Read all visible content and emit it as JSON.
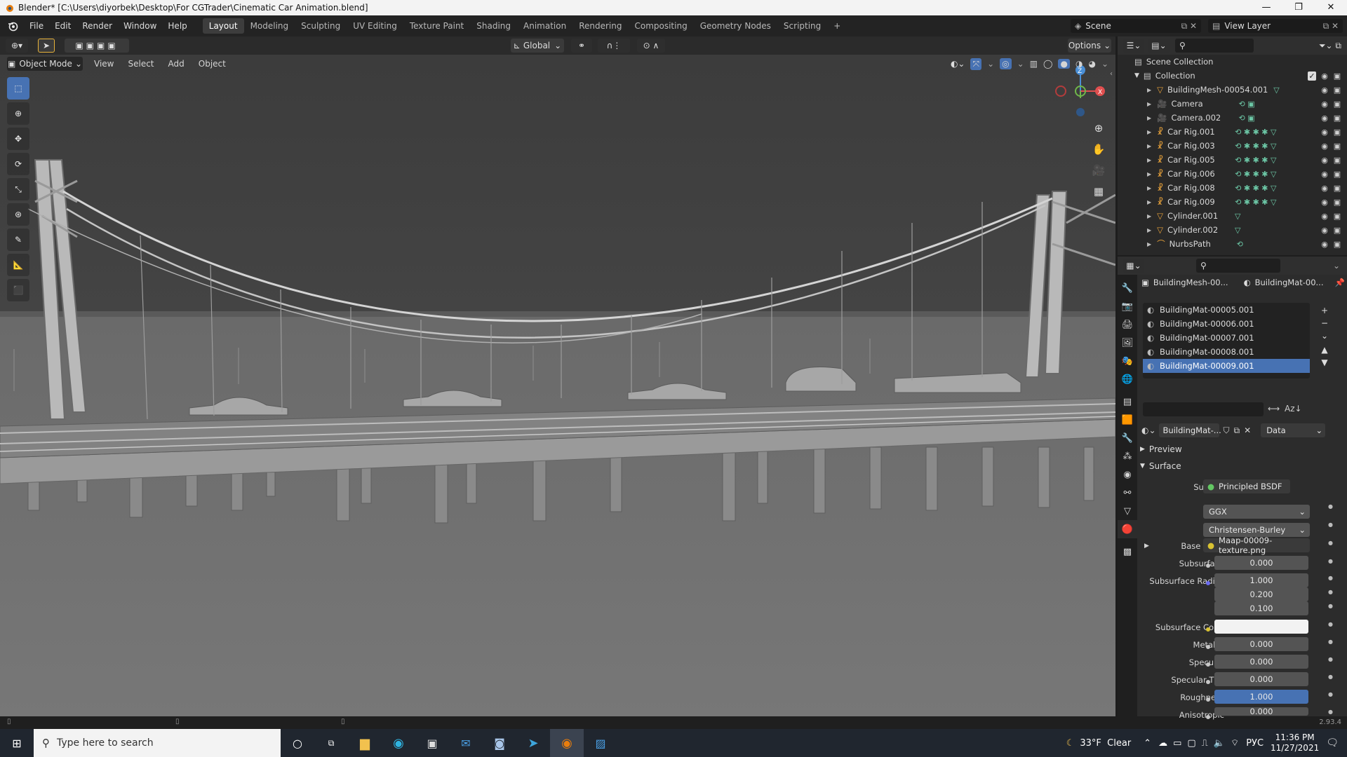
{
  "window": {
    "title": "Blender* [C:\\Users\\diyorbek\\Desktop\\For CGTrader\\Cinematic Car Animation.blend]",
    "controls": [
      "—",
      "❐",
      "✕"
    ]
  },
  "menu": {
    "items": [
      "File",
      "Edit",
      "Render",
      "Window",
      "Help"
    ]
  },
  "workspaces": [
    "Layout",
    "Modeling",
    "Sculpting",
    "UV Editing",
    "Texture Paint",
    "Shading",
    "Animation",
    "Rendering",
    "Compositing",
    "Geometry Nodes",
    "Scripting",
    "+"
  ],
  "active_workspace": "Layout",
  "scene": {
    "name": "Scene",
    "view_layer": "View Layer"
  },
  "viewport_header": {
    "transform_orientation": "Global",
    "options": "Options",
    "mode": "Object Mode",
    "menus": [
      "View",
      "Select",
      "Add",
      "Object"
    ]
  },
  "gizmo": {
    "z": "Z",
    "x": "X",
    "y": "Y"
  },
  "outliner": {
    "scene_collection": "Scene Collection",
    "collection": "Collection",
    "items": [
      {
        "name": "BuildingMesh-00054.001",
        "type": "mesh"
      },
      {
        "name": "Camera",
        "type": "camera"
      },
      {
        "name": "Camera.002",
        "type": "camera"
      },
      {
        "name": "Car Rig.001",
        "type": "armature"
      },
      {
        "name": "Car Rig.003",
        "type": "armature"
      },
      {
        "name": "Car Rig.005",
        "type": "armature"
      },
      {
        "name": "Car Rig.006",
        "type": "armature"
      },
      {
        "name": "Car Rig.008",
        "type": "armature"
      },
      {
        "name": "Car Rig.009",
        "type": "armature"
      },
      {
        "name": "Cylinder.001",
        "type": "mesh"
      },
      {
        "name": "Cylinder.002",
        "type": "mesh"
      },
      {
        "name": "NurbsPath",
        "type": "curve"
      }
    ]
  },
  "properties": {
    "breadcrumb_object": "BuildingMesh-00...",
    "breadcrumb_material": "BuildingMat-00...",
    "materials": [
      "BuildingMat-00005.001",
      "BuildingMat-00006.001",
      "BuildingMat-00007.001",
      "BuildingMat-00008.001",
      "BuildingMat-00009.001"
    ],
    "selected_material": "BuildingMat-00009.001",
    "material_slot": "BuildingMat-...",
    "link": "Data",
    "panels": {
      "preview": "Preview",
      "surface": "Surface"
    },
    "surface": {
      "surface_label": "Surface",
      "surface_value": "Principled BSDF",
      "distribution": "GGX",
      "subsurface_method": "Christensen-Burley",
      "base_color_label": "Base Color",
      "base_color_value": "Maap-00009-texture.png",
      "subsurface_label": "Subsurface",
      "subsurface_value": "0.000",
      "subsurface_radius_label": "Subsurface Radius",
      "subsurface_radius": [
        "1.000",
        "0.200",
        "0.100"
      ],
      "subsurface_color_label": "Subsurface Color",
      "metallic_label": "Metallic",
      "metallic_value": "0.000",
      "specular_label": "Specular",
      "specular_value": "0.000",
      "specular_tint_label": "Specular Tint",
      "specular_tint_value": "0.000",
      "roughness_label": "Roughness",
      "roughness_value": "1.000",
      "anisotropic_label": "Anisotropic",
      "anisotropic_value": "0.000"
    }
  },
  "status": {
    "version": "2.93.4"
  },
  "taskbar": {
    "search_placeholder": "Type here to search",
    "weather": "33°F  Clear",
    "language": "РУС",
    "time": "11:36 PM",
    "date": "11/27/2021"
  },
  "colors": {
    "accent": "#4772b3",
    "viewport": "#3d3d3d",
    "panel": "#2c2c2c"
  }
}
